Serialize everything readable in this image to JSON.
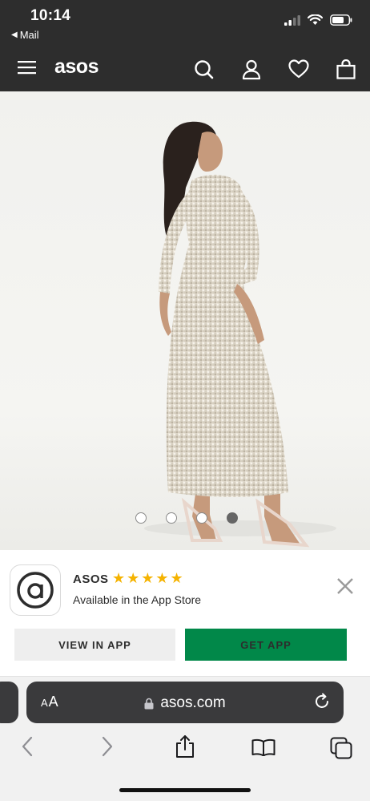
{
  "status_bar": {
    "time": "10:14",
    "back_app": "Mail"
  },
  "header": {
    "logo": "asos"
  },
  "hero": {
    "image_count": 4,
    "active_index": 3
  },
  "banner": {
    "app_name": "ASOS",
    "rating_stars": "★★★★★",
    "subtitle": "Available in the App Store",
    "view_button": "VIEW IN APP",
    "get_button": "GET APP"
  },
  "safari": {
    "aa_large": "A",
    "aa_small": "A",
    "url": "asos.com"
  },
  "colors": {
    "header_bg": "#2d2d2d",
    "get_app_green": "#018849",
    "stars": "#f5b301"
  }
}
